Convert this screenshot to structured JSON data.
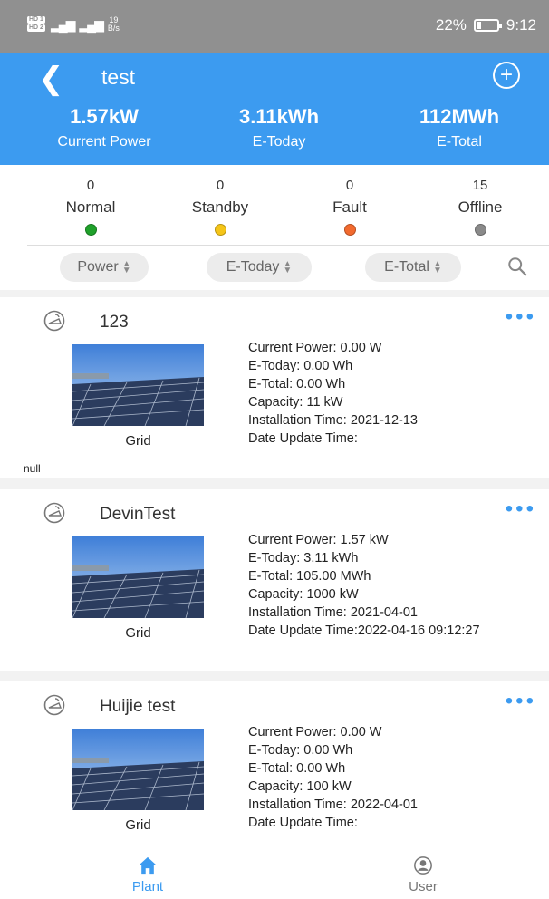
{
  "status_bar": {
    "network_speed_value": "19",
    "network_speed_unit": "B/s",
    "battery": "22%",
    "time": "9:12"
  },
  "header": {
    "title": "test",
    "stats": [
      {
        "value": "1.57kW",
        "label": "Current Power"
      },
      {
        "value": "3.11kWh",
        "label": "E-Today"
      },
      {
        "value": "112MWh",
        "label": "E-Total"
      }
    ]
  },
  "summary": {
    "items": [
      {
        "count": "0",
        "label": "Normal",
        "color": "#1fa12a"
      },
      {
        "count": "0",
        "label": "Standby",
        "color": "#f5c518"
      },
      {
        "count": "0",
        "label": "Fault",
        "color": "#f26a2e"
      },
      {
        "count": "15",
        "label": "Offline",
        "color": "#8a8a8a"
      }
    ],
    "sort_options": [
      "Power",
      "E-Today",
      "E-Total"
    ]
  },
  "plants": [
    {
      "name": "123",
      "type": "Grid",
      "info": [
        "Current Power: 0.00 W",
        "E-Today: 0.00 Wh",
        "E-Total: 0.00 Wh",
        "Capacity: 11 kW",
        "Installation Time: 2021-12-13",
        "Date Update Time:"
      ],
      "extra": "null"
    },
    {
      "name": "DevinTest",
      "type": "Grid",
      "info": [
        "Current Power: 1.57 kW",
        "E-Today: 3.11 kWh",
        "E-Total: 105.00 MWh",
        "Capacity: 1000 kW",
        "Installation Time: 2021-04-01",
        "Date Update Time:2022-04-16 09:12:27"
      ]
    },
    {
      "name": "Huijie test",
      "type": "Grid",
      "info": [
        "Current Power: 0.00 W",
        "E-Today: 0.00 Wh",
        "E-Total: 0.00 Wh",
        "Capacity: 100 kW",
        "Installation Time: 2022-04-01",
        "Date Update Time:"
      ]
    }
  ],
  "bottom_nav": [
    {
      "label": "Plant",
      "icon": "home-icon",
      "active": true,
      "color": "#3c9bf0"
    },
    {
      "label": "User",
      "icon": "user-icon",
      "active": false,
      "color": "#777777"
    }
  ],
  "colors": {
    "accent": "#3c9bf0",
    "status_bar": "#909090"
  }
}
